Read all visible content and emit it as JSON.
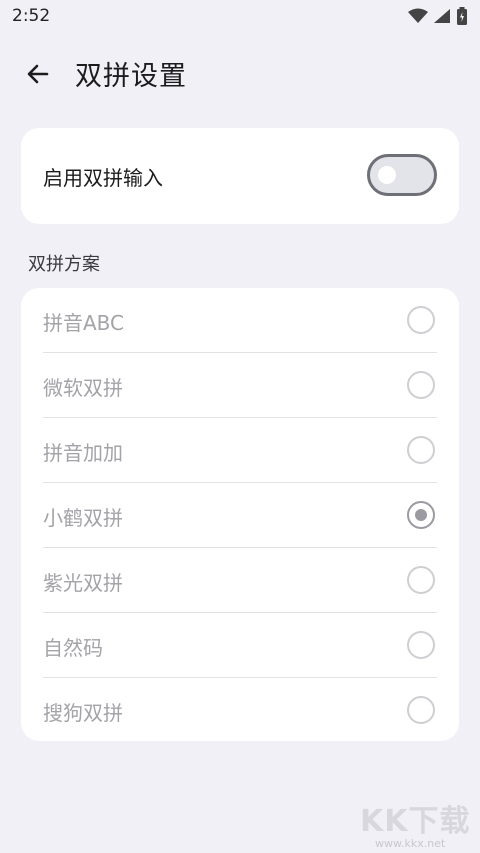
{
  "status_bar": {
    "time": "2:52",
    "icons": [
      "wifi-icon",
      "signal-icon",
      "battery-icon"
    ]
  },
  "app_bar": {
    "back_icon": "arrow-left-icon",
    "title": "双拼设置"
  },
  "toggle": {
    "label": "启用双拼输入",
    "enabled": false
  },
  "scheme_section": {
    "header": "双拼方案",
    "options": [
      {
        "label": "拼音ABC",
        "selected": false
      },
      {
        "label": "微软双拼",
        "selected": false
      },
      {
        "label": "拼音加加",
        "selected": false
      },
      {
        "label": "小鹤双拼",
        "selected": true
      },
      {
        "label": "紫光双拼",
        "selected": false
      },
      {
        "label": "自然码",
        "selected": false
      },
      {
        "label": "搜狗双拼",
        "selected": false
      }
    ]
  },
  "watermark": {
    "logo": "KK下载",
    "url": "www.kkx.net"
  }
}
